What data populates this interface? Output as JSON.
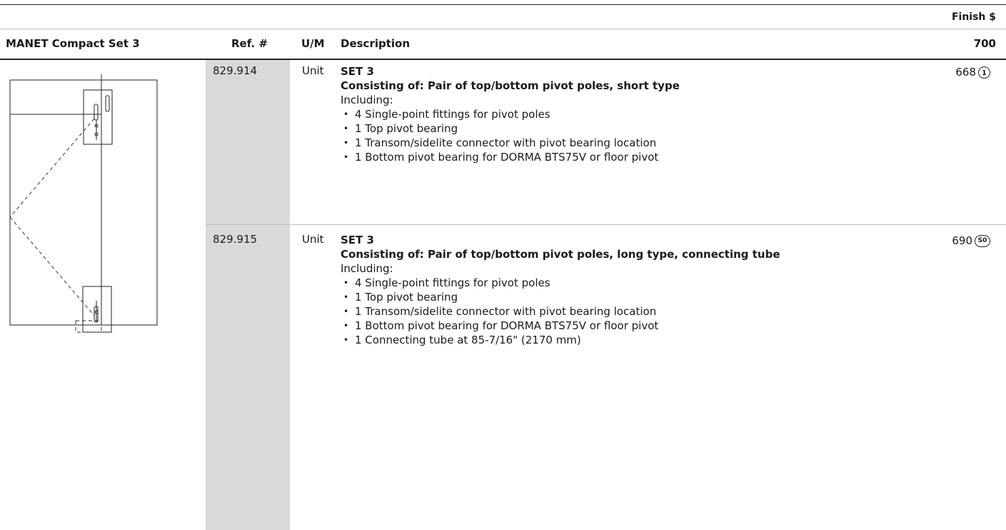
{
  "finish_label": "Finish $",
  "header": {
    "title": "MANET Compact Set 3",
    "ref": "Ref. #",
    "um": "U/M",
    "description": "Description",
    "finish_code": "700"
  },
  "items": [
    {
      "ref": "829.914",
      "um": "Unit",
      "title": "SET 3",
      "subtitle": "Consisting of: Pair of top/bottom pivot poles, short type",
      "including": "Including:",
      "bullets": [
        "4 Single-point fittings for pivot poles",
        "1 Top pivot bearing",
        "1 Transom/sidelite connector with pivot bearing location",
        "1 Bottom pivot bearing for DORMA BTS75V or floor pivot"
      ],
      "price": "668",
      "badge": "1"
    },
    {
      "ref": "829.915",
      "um": "Unit",
      "title": "SET 3",
      "subtitle": "Consisting of: Pair of top/bottom pivot poles, long type, connecting tube",
      "including": "Including:",
      "bullets": [
        "4 Single-point fittings for pivot poles",
        "1 Top pivot bearing",
        "1 Transom/sidelite connector with pivot bearing location",
        "1 Bottom pivot bearing for DORMA BTS75V or floor pivot",
        "1 Connecting tube at 85-7/16\" (2170 mm)"
      ],
      "price": "690",
      "badge": "S0"
    }
  ]
}
